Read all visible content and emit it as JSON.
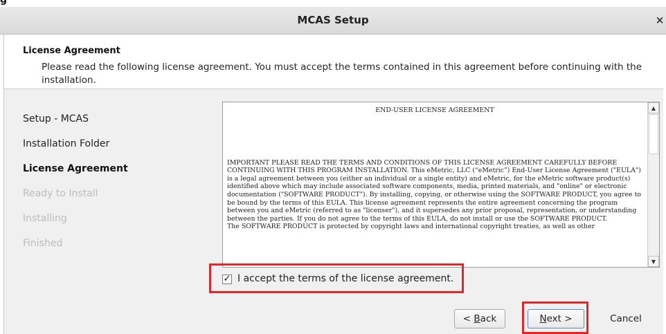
{
  "window": {
    "title": "MCAS Setup",
    "close_glyph": "×",
    "top_fragment": "g"
  },
  "header": {
    "title": "License Agreement",
    "description": "Please read the following license agreement. You must accept the terms contained in this agreement before continuing with the installation."
  },
  "steps": [
    {
      "label": "Setup - MCAS",
      "state": "done"
    },
    {
      "label": "Installation Folder",
      "state": "done"
    },
    {
      "label": "License Agreement",
      "state": "active"
    },
    {
      "label": "Ready to Install",
      "state": "pending"
    },
    {
      "label": "Installing",
      "state": "pending"
    },
    {
      "label": "Finished",
      "state": "pending"
    }
  ],
  "eula": {
    "title": "END-USER LICENSE AGREEMENT",
    "paragraph1": "IMPORTANT PLEASE READ THE TERMS AND CONDITIONS OF THIS LICENSE AGREEMENT CAREFULLY BEFORE CONTINUING WITH THIS PROGRAM INSTALLATION. This eMetric, LLC (“eMetric”) End-User License Agreement (\"EULA\") is a legal agreement between you (either an individual or a single entity) and eMetric, for the eMetric software product(s) identified above which may include associated software components, media, printed materials, and \"online\" or electronic documentation (\"SOFTWARE PRODUCT\"). By installing, copying, or otherwise using the SOFTWARE PRODUCT, you agree to be bound by the terms of this EULA. This license agreement represents the entire agreement concerning the program between you and eMetric (referred to as \"licenser\"), and it supersedes any prior proposal, representation, or understanding between the parties. If you do not agree to the terms of this EULA, do not install or use the SOFTWARE PRODUCT.",
    "paragraph2": "The SOFTWARE PRODUCT is protected by copyright laws and international copyright treaties, as well as other"
  },
  "accept": {
    "label": "I accept the terms of the license agreement.",
    "checked": true,
    "check_glyph": "✓"
  },
  "buttons": {
    "back_mnemonic": "B",
    "back_rest": "ack",
    "back_prefix": "< ",
    "next_mnemonic": "N",
    "next_rest": "ext >",
    "cancel": "Cancel"
  },
  "scroll_glyphs": {
    "up": "▲",
    "down": "▼"
  },
  "colors": {
    "highlight": "#e32626",
    "panel": "#f0f0f0",
    "dim_step": "#bcbcbc"
  }
}
